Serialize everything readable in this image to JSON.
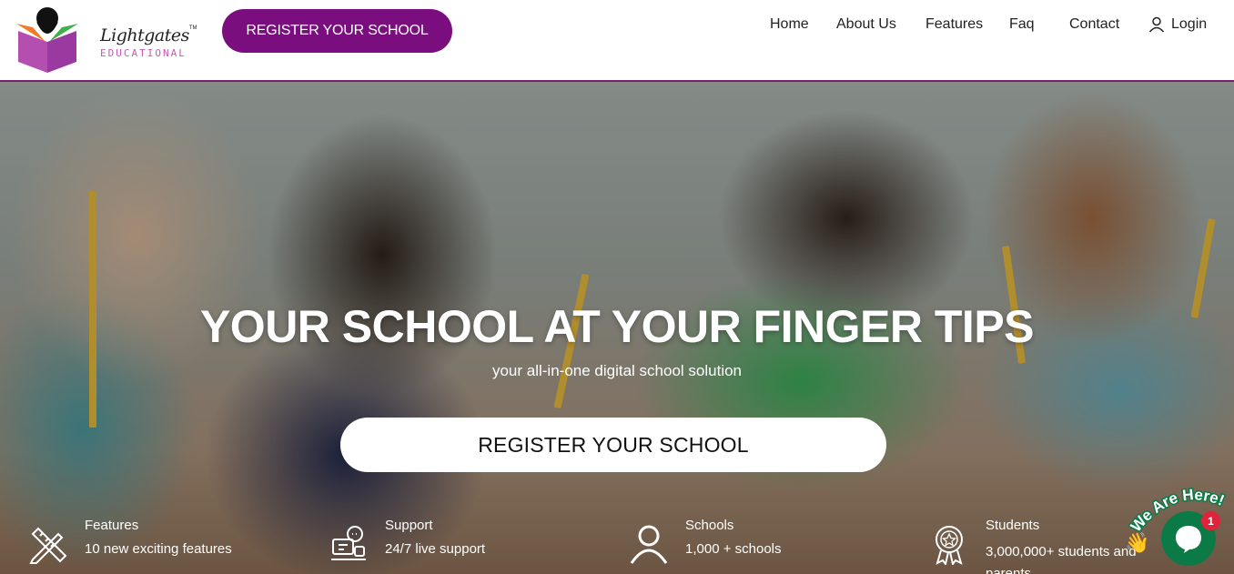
{
  "header": {
    "logo": {
      "brand": "Lightgates",
      "tm": "TM",
      "sub": "EDUCATIONAL"
    },
    "register_button": "REGISTER YOUR SCHOOL",
    "nav": [
      {
        "label": "Home"
      },
      {
        "label": "About Us"
      },
      {
        "label": "Features"
      },
      {
        "label": "Faq"
      },
      {
        "label": "Contact"
      }
    ],
    "login_label": "Login"
  },
  "hero": {
    "title": "YOUR SCHOOL AT YOUR FINGER TIPS",
    "subtitle": "your all-in-one digital school solution",
    "register_button": "REGISTER YOUR SCHOOL"
  },
  "stats": [
    {
      "label": "Features",
      "value": "10 new exciting features",
      "icon": "pencil-ruler-icon"
    },
    {
      "label": "Support",
      "value": "24/7 live support",
      "icon": "support-chat-icon"
    },
    {
      "label": "Schools",
      "value": "1,000 + schools",
      "icon": "user-icon"
    },
    {
      "label": "Students",
      "value": "3,000,000+ students and parents",
      "icon": "award-medal-icon"
    }
  ],
  "chat": {
    "tagline": "We Are Here!",
    "badge_count": "1",
    "wave_icon": "waving-hand-icon"
  },
  "colors": {
    "brand_purple": "#7b0e7e",
    "header_border": "#7a1f6b",
    "chat_green": "#0c7a46",
    "badge_red": "#e0233a"
  }
}
